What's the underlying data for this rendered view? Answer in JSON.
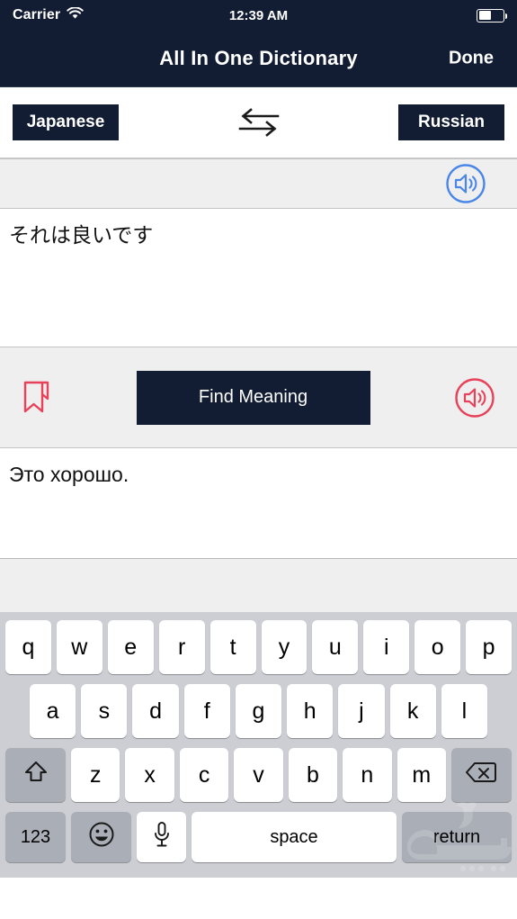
{
  "status_bar": {
    "carrier": "Carrier",
    "wifi_icon": "wifi-icon",
    "time": "12:39 AM",
    "battery_icon": "battery-icon",
    "battery_level_pct": 52
  },
  "nav_bar": {
    "title": "All In One Dictionary",
    "done_label": "Done"
  },
  "language_bar": {
    "source_language": "Japanese",
    "target_language": "Russian",
    "swap_icon": "swap-arrows-icon"
  },
  "source_panel": {
    "speaker_icon": "speaker-icon",
    "text": "それは良いです"
  },
  "action_bar": {
    "bookmark_icon": "bookmark-icon",
    "find_meaning_label": "Find Meaning",
    "speaker_icon": "speaker-icon"
  },
  "target_panel": {
    "text": "Это хорошо."
  },
  "keyboard": {
    "row1": [
      "q",
      "w",
      "e",
      "r",
      "t",
      "y",
      "u",
      "i",
      "o",
      "p"
    ],
    "row2": [
      "a",
      "s",
      "d",
      "f",
      "g",
      "h",
      "j",
      "k",
      "l"
    ],
    "row3": [
      "z",
      "x",
      "c",
      "v",
      "b",
      "n",
      "m"
    ],
    "shift_icon": "shift-arrow-icon",
    "backspace_icon": "backspace-icon",
    "numbers_label": "123",
    "emoji_icon": "emoji-smiley-icon",
    "mic_icon": "microphone-icon",
    "space_label": "space",
    "return_label": "return"
  },
  "colors": {
    "navy": "#121c33",
    "blue_accent": "#4a86e8",
    "red_accent": "#e8415a",
    "keyboard_bg": "#ccced4",
    "panel_gray": "#efefef"
  },
  "watermark": {
    "name": "arabic-script-watermark"
  }
}
